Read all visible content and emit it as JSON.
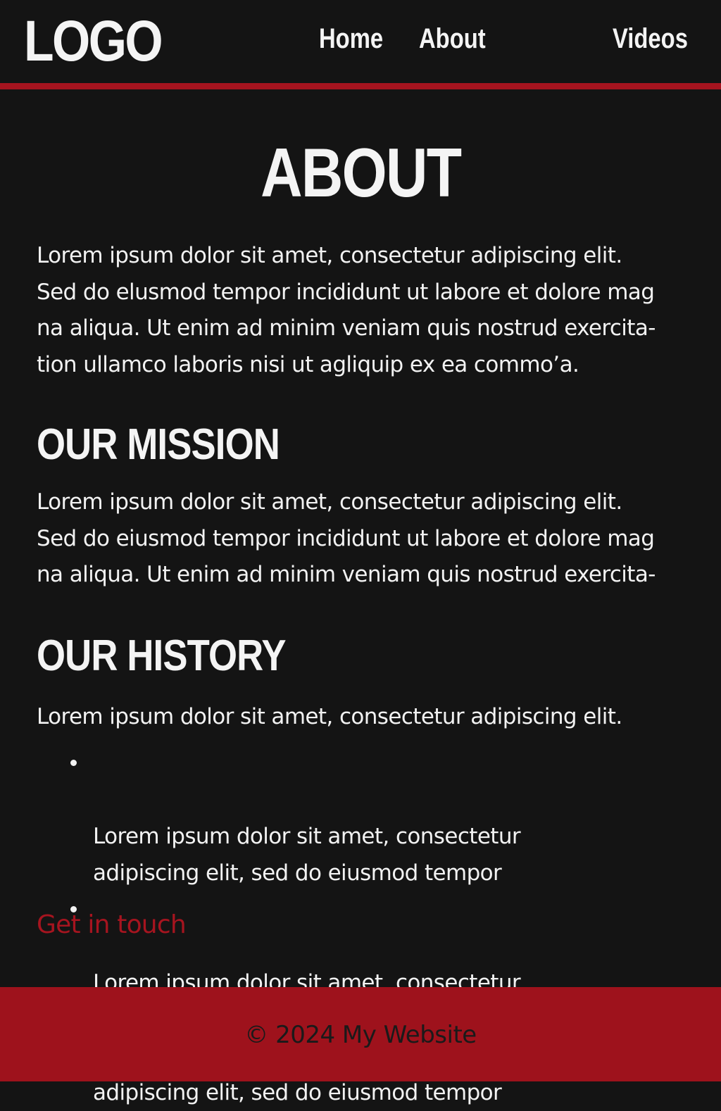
{
  "header": {
    "logo": "LOGO",
    "nav": {
      "home": "Home",
      "about": "About",
      "videos": "Videos"
    }
  },
  "main": {
    "title": "ABOUT",
    "intro": "Lorem ipsum dolor sit amet, consectetur adipiscing elit.\nSed do elusmod tempor incididunt ut labore et dolore mag\nna aliqua. Ut enim ad minim veniam quis nostrud exercita-\ntion ullamco laboris nisi ut agliquip ex ea commo’a.",
    "mission": {
      "heading": "OUR MISSION",
      "text": "Lorem ipsum dolor sit amet, consectetur adipiscing elit.\nSed do eiusmod tempor incididunt ut labore et dolore mag\nna aliqua. Ut enim ad minim veniam quis nostrud exercita-"
    },
    "history": {
      "heading": "OUR HISTORY",
      "text": "Lorem ipsum dolor sit amet, consectetur adipiscing elit.",
      "bullets": [
        "Lorem ipsum dolor sit amet, consectetur\nadipiscing elit, sed do eiusmod tempor",
        "Lorem ipsum dolor sit amet, consectetur",
        "adipiscing elit, sed do eiusmod tempor"
      ]
    },
    "cta": "Get in touch"
  },
  "footer": {
    "text": "© 2024 My Website"
  },
  "colors": {
    "background": "#141414",
    "accent": "#a6141f",
    "footer": "#9e121c",
    "text": "#f2f2f2"
  }
}
